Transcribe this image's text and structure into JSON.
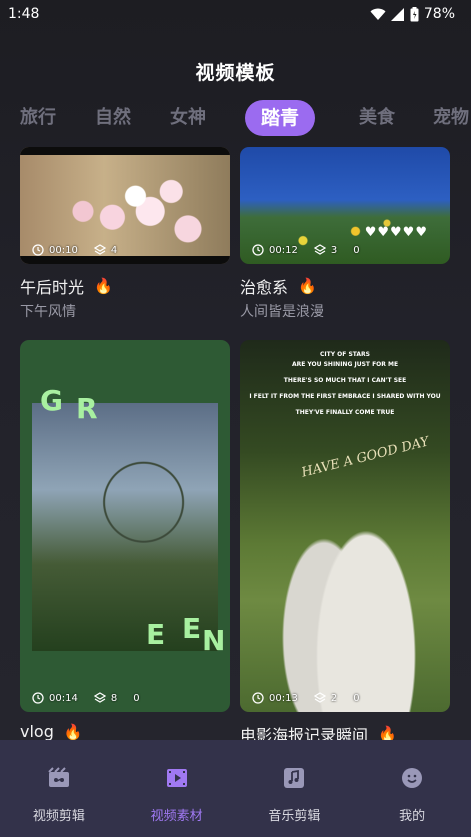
{
  "status": {
    "time": "1:48",
    "battery": "78%"
  },
  "header": {
    "title": "视频模板"
  },
  "tabs": [
    {
      "label": "旅行"
    },
    {
      "label": "自然"
    },
    {
      "label": "女神"
    },
    {
      "label": "踏青",
      "active": true
    },
    {
      "label": "美食"
    },
    {
      "label": "宠物"
    }
  ],
  "cards": [
    {
      "title": "午后时光",
      "subtitle": "下午风情",
      "duration": "00:10",
      "layers": "4",
      "extra": ""
    },
    {
      "title": "治愈系",
      "subtitle": "人间皆是浪漫",
      "duration": "00:12",
      "layers": "3",
      "extra": "0"
    },
    {
      "title": "vlog",
      "subtitle": "",
      "duration": "00:14",
      "layers": "8",
      "extra": "0"
    },
    {
      "title": "电影海报记录瞬间",
      "subtitle": "",
      "duration": "00:13",
      "layers": "2",
      "extra": "0"
    }
  ],
  "thumb_text": {
    "hearts": "♥♥♥♥♥",
    "green_letters": [
      "G",
      "R",
      "E",
      "E",
      "N"
    ],
    "poster_lines": [
      "CITY OF STARS",
      "ARE YOU SHINING JUST FOR ME",
      "THERE'S SO MUCH THAT I CAN'T SEE",
      "I FELT IT FROM THE FIRST EMBRACE I SHARED WITH YOU",
      "THEY'VE FINALLY COME TRUE"
    ],
    "poster_script": "HAVE A GOOD DAY"
  },
  "bottom_nav": [
    {
      "label": "视频剪辑",
      "icon": "film-clip-icon"
    },
    {
      "label": "视频素材",
      "icon": "video-play-icon",
      "active": true
    },
    {
      "label": "音乐剪辑",
      "icon": "music-note-icon"
    },
    {
      "label": "我的",
      "icon": "face-icon"
    }
  ],
  "colors": {
    "accent": "#9b6bf0",
    "nav_bg": "#33324a",
    "fire": "#ff7a1a"
  }
}
